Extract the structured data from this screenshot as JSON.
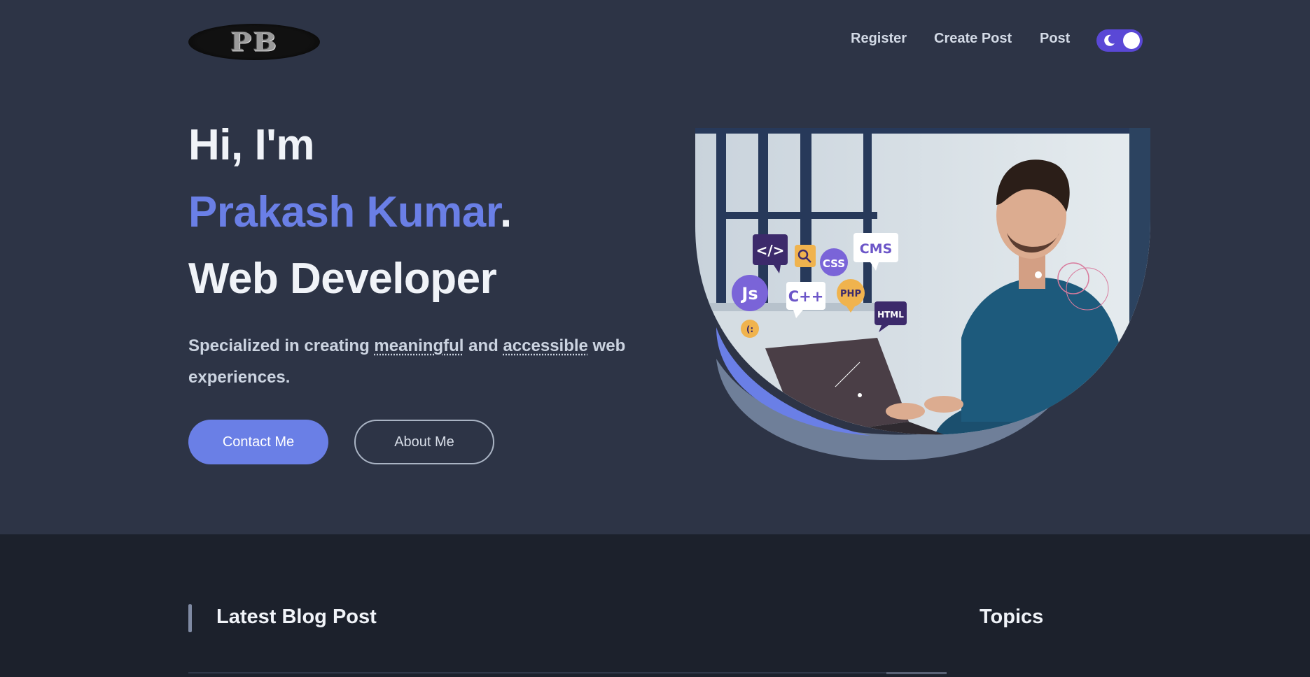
{
  "header": {
    "logo_text": "PB",
    "nav": {
      "register": "Register",
      "create_post": "Create Post",
      "post": "Post"
    },
    "theme_toggle": {
      "icon": "moon-icon",
      "state": "dark"
    }
  },
  "hero": {
    "greeting": "Hi, I'm",
    "name": "Prakash Kumar",
    "name_suffix": ".",
    "role": "Web Developer",
    "tagline": {
      "part1": "Specialized in creating ",
      "highlight1": "meaningful",
      "part2": " and ",
      "highlight2": "accessible",
      "part3": " web experiences."
    },
    "buttons": {
      "contact": "Contact Me",
      "about": "About Me"
    },
    "illustration": {
      "bubbles": [
        "</>",
        "CSS",
        "CMS",
        "Js",
        "C++",
        "PHP",
        "HTML"
      ]
    }
  },
  "blog": {
    "latest_title": "Latest Blog Post",
    "topics_title": "Topics"
  },
  "colors": {
    "background": "#2d3446",
    "section_dark": "#1c212c",
    "accent": "#6a7fe6",
    "toggle": "#5a48d6"
  }
}
